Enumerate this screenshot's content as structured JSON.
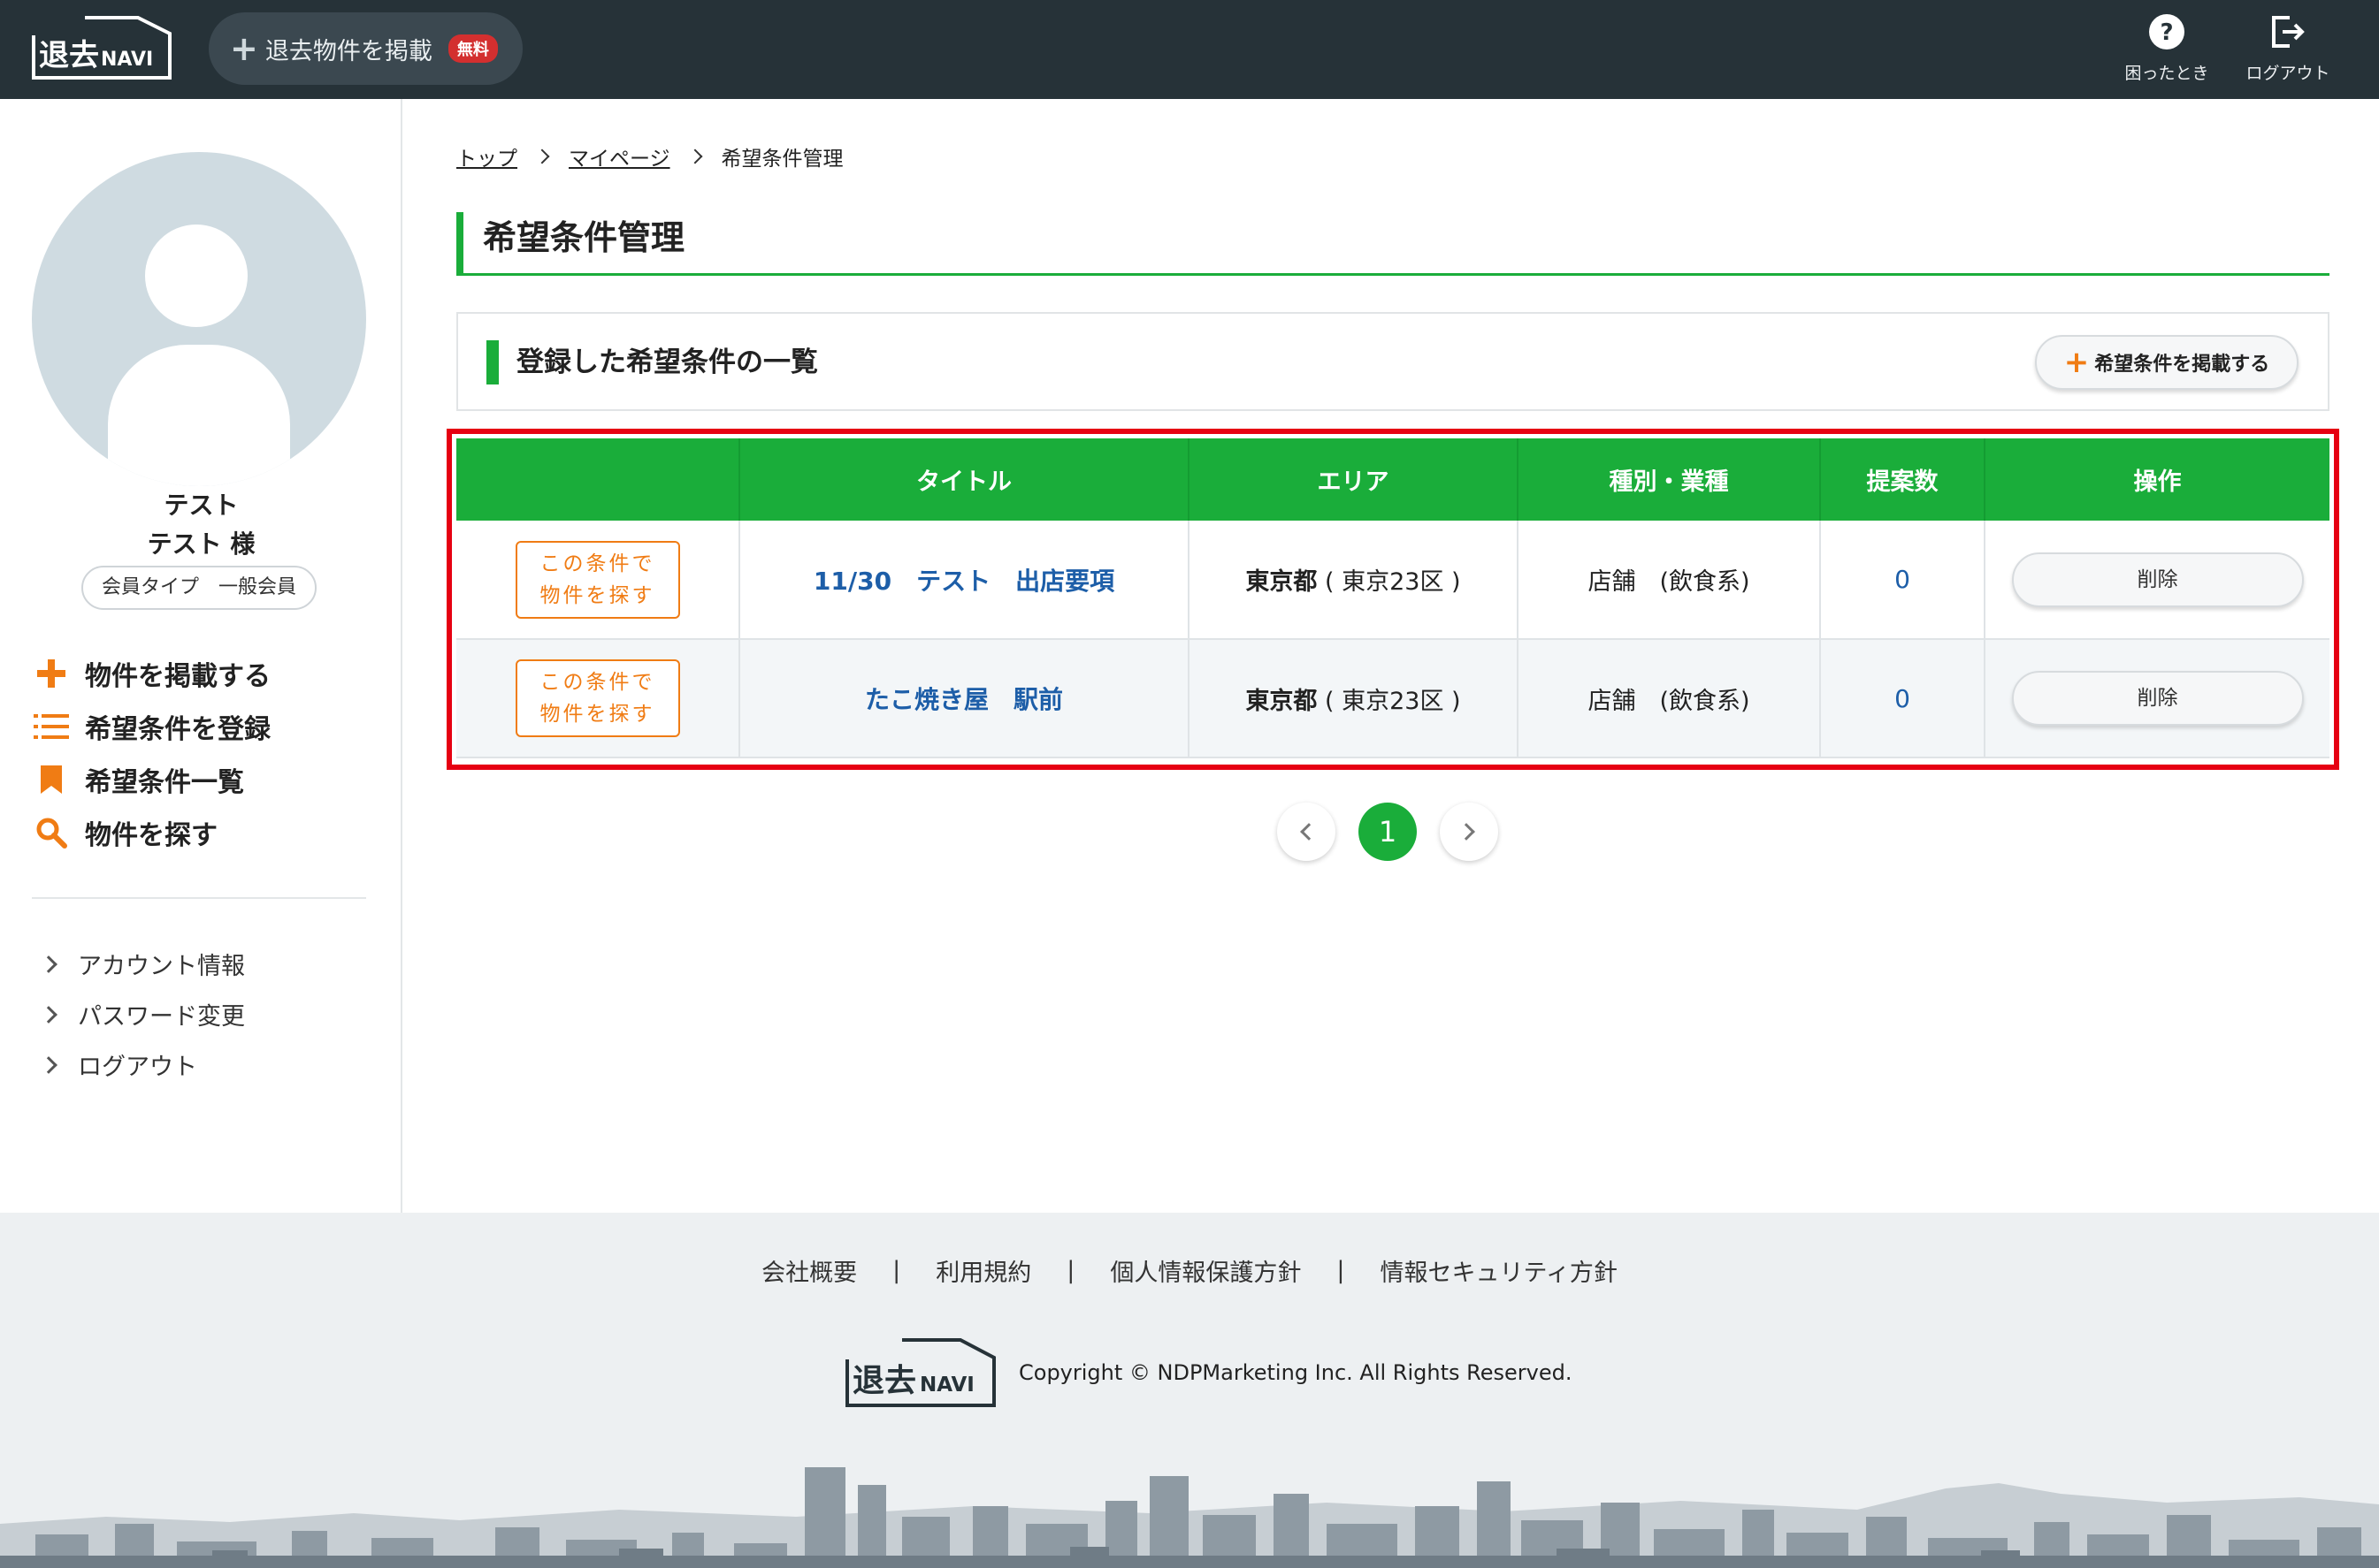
{
  "header": {
    "logo_text": "退去NAVI",
    "post_label": "退去物件を掲載",
    "post_badge": "無料",
    "help_label": "困ったとき",
    "logout_label": "ログアウト"
  },
  "sidebar": {
    "user_name": "テスト",
    "user_name_honorific": "テスト 様",
    "member_type": "会員タイプ　一般会員",
    "menu": [
      {
        "label": "物件を掲載する",
        "icon": "plus-icon"
      },
      {
        "label": "希望条件を登録",
        "icon": "list-icon"
      },
      {
        "label": "希望条件一覧",
        "icon": "bookmark-icon"
      },
      {
        "label": "物件を探す",
        "icon": "search-icon"
      }
    ],
    "submenu": [
      "アカウント情報",
      "パスワード変更",
      "ログアウト"
    ]
  },
  "breadcrumb": [
    "トップ",
    "マイページ",
    "希望条件管理"
  ],
  "page_title": "希望条件管理",
  "list": {
    "heading": "登録した希望条件の一覧",
    "add_button": "希望条件を掲載する",
    "columns": [
      "",
      "タイトル",
      "エリア",
      "種別・業種",
      "提案数",
      "操作"
    ],
    "search_button_line1": "この条件で",
    "search_button_line2": "物件を探す",
    "delete_label": "削除",
    "rows": [
      {
        "title": "11/30　テスト　出店要項",
        "pref": "東京都",
        "area": "( 東京23区 )",
        "type": "店舗　(飲食系)",
        "count": "0"
      },
      {
        "title": "たこ焼き屋　駅前",
        "pref": "東京都",
        "area": "( 東京23区 )",
        "type": "店舗　(飲食系)",
        "count": "0"
      }
    ]
  },
  "pager": {
    "current": "1"
  },
  "footer": {
    "links": [
      "会社概要",
      "利用規約",
      "個人情報保護方針",
      "情報セキュリティ方針"
    ],
    "separator": "|",
    "copyright": "Copyright © NDPMarketing Inc. All Rights Reserved."
  },
  "colors": {
    "header": "#263238",
    "accent_green": "#1aad3a",
    "accent_orange": "#f07c14",
    "highlight_red": "#e60012",
    "link_blue": "#1d5ea8"
  }
}
